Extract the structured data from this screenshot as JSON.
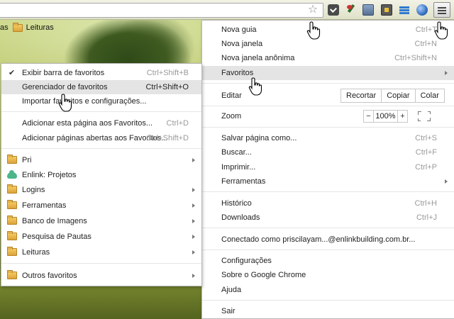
{
  "bookmarks_bar": {
    "partial_item": "as",
    "leituras": "Leituras"
  },
  "main_menu": {
    "nova_guia": {
      "label": "Nova guia",
      "shortcut": "Ctrl+T"
    },
    "nova_janela": {
      "label": "Nova janela",
      "shortcut": "Ctrl+N"
    },
    "nova_janela_anonima": {
      "label": "Nova janela anônima",
      "shortcut": "Ctrl+Shift+N"
    },
    "favoritos": {
      "label": "Favoritos"
    },
    "editar": {
      "label": "Editar",
      "recortar": "Recortar",
      "copiar": "Copiar",
      "colar": "Colar"
    },
    "zoom": {
      "label": "Zoom",
      "minus": "−",
      "value": "100%",
      "plus": "+"
    },
    "salvar": {
      "label": "Salvar página como...",
      "shortcut": "Ctrl+S"
    },
    "buscar": {
      "label": "Buscar...",
      "shortcut": "Ctrl+F"
    },
    "imprimir": {
      "label": "Imprimir...",
      "shortcut": "Ctrl+P"
    },
    "ferramentas": {
      "label": "Ferramentas"
    },
    "historico": {
      "label": "Histórico",
      "shortcut": "Ctrl+H"
    },
    "downloads": {
      "label": "Downloads",
      "shortcut": "Ctrl+J"
    },
    "conectado": {
      "label": "Conectado como priscilayam...@enlinkbuilding.com.br..."
    },
    "configuracoes": {
      "label": "Configurações"
    },
    "sobre": {
      "label": "Sobre o Google Chrome"
    },
    "ajuda": {
      "label": "Ajuda"
    },
    "sair": {
      "label": "Sair"
    }
  },
  "favorites_menu": {
    "exibir": {
      "label": "Exibir barra de favoritos",
      "shortcut": "Ctrl+Shift+B"
    },
    "gerenciador": {
      "label": "Gerenciador de favoritos",
      "shortcut": "Ctrl+Shift+O"
    },
    "importar": {
      "label": "Importar favoritos e configurações..."
    },
    "adicionar_pagina": {
      "label": "Adicionar esta página aos Favoritos...",
      "shortcut": "Ctrl+D"
    },
    "adicionar_abertas": {
      "label": "Adicionar páginas abertas aos Favoritos...",
      "shortcut": "Ctrl+Shift+D"
    },
    "folders": [
      {
        "label": "Pri"
      },
      {
        "label": "Enlink: Projetos"
      },
      {
        "label": "Logins"
      },
      {
        "label": "Ferramentas"
      },
      {
        "label": "Banco de Imagens"
      },
      {
        "label": "Pesquisa de Pautas"
      },
      {
        "label": "Leituras"
      }
    ],
    "outros": {
      "label": "Outros favoritos"
    }
  },
  "icons": {
    "star": "star-icon",
    "menu": "hamburger-menu-icon",
    "check": "check-icon",
    "folder": "folder-icon",
    "cursor": "hand-cursor-icon"
  }
}
